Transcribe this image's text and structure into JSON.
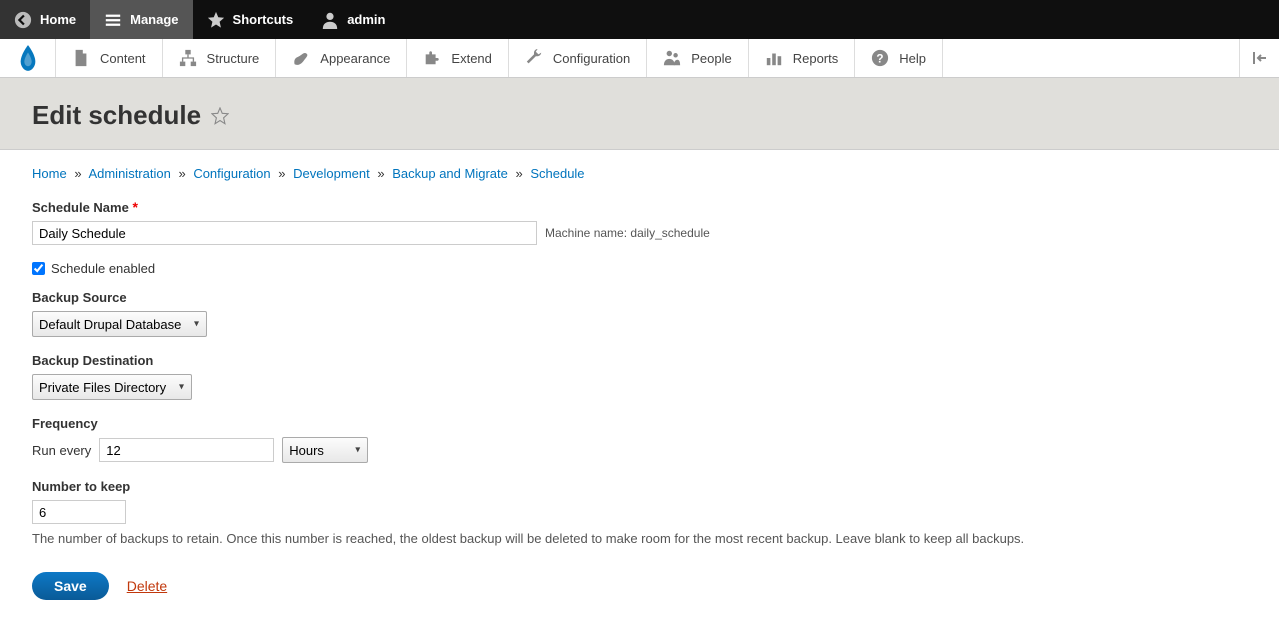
{
  "toolbar": {
    "home": "Home",
    "manage": "Manage",
    "shortcuts": "Shortcuts",
    "user": "admin"
  },
  "admin_menu": {
    "content": "Content",
    "structure": "Structure",
    "appearance": "Appearance",
    "extend": "Extend",
    "configuration": "Configuration",
    "people": "People",
    "reports": "Reports",
    "help": "Help"
  },
  "page_title": "Edit schedule",
  "breadcrumb": {
    "home": "Home",
    "administration": "Administration",
    "configuration": "Configuration",
    "development": "Development",
    "backup_migrate": "Backup and Migrate",
    "schedule": "Schedule"
  },
  "form": {
    "schedule_name_label": "Schedule Name",
    "schedule_name_value": "Daily Schedule",
    "machine_name_label": "Machine name:",
    "machine_name_value": "daily_schedule",
    "enabled_label": "Schedule enabled",
    "enabled_checked": true,
    "backup_source_label": "Backup Source",
    "backup_source_value": "Default Drupal Database",
    "backup_destination_label": "Backup Destination",
    "backup_destination_value": "Private Files Directory",
    "frequency_label": "Frequency",
    "frequency_prefix": "Run every",
    "frequency_value": "12",
    "frequency_unit": "Hours",
    "number_to_keep_label": "Number to keep",
    "number_to_keep_value": "6",
    "number_to_keep_desc": "The number of backups to retain. Once this number is reached, the oldest backup will be deleted to make room for the most recent backup. Leave blank to keep all backups.",
    "save_label": "Save",
    "delete_label": "Delete"
  }
}
